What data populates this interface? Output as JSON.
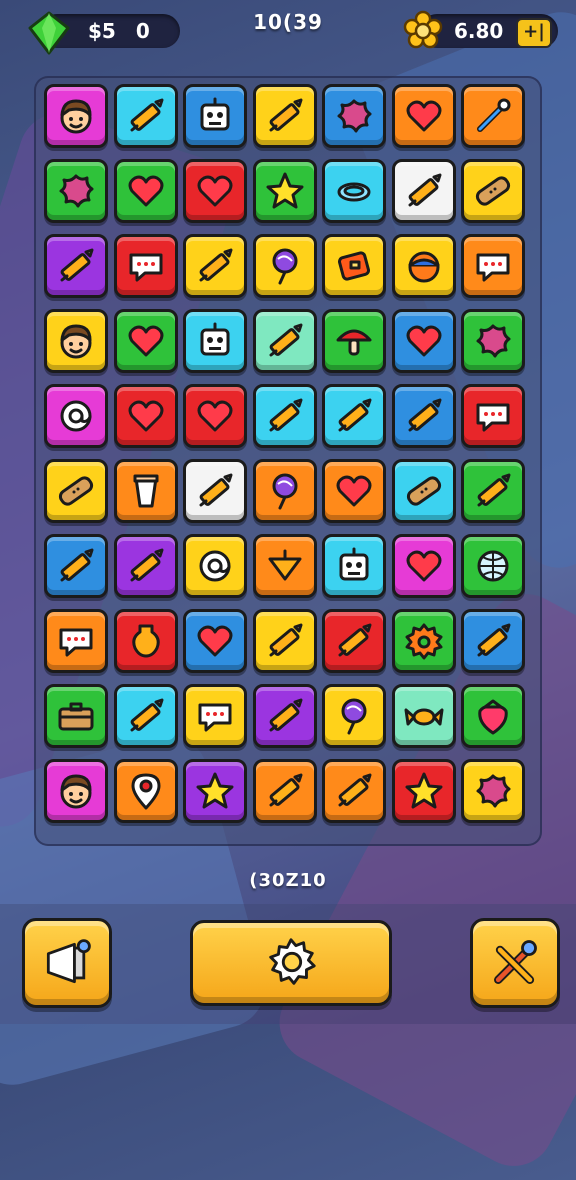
{
  "hud": {
    "currency_label": "$5",
    "currency_value": "0",
    "level_text": "10(39",
    "coins_value": "6.80",
    "add_label": "+|"
  },
  "score_text": "(30Z10",
  "colors": {
    "magenta": "#e63bd6",
    "cyan": "#3cd2f0",
    "blue": "#2f8fe0",
    "yellow": "#ffd21a",
    "orange": "#ff8a1a",
    "green": "#2fc23a",
    "red": "#e8262a",
    "purple": "#9b35e0",
    "white": "#f4f4f4",
    "mint": "#7fe8c0",
    "lime": "#c6e82a"
  },
  "board": {
    "rows": [
      [
        {
          "bg": "magenta",
          "icon": "face-icon"
        },
        {
          "bg": "cyan",
          "icon": "pencil-icon"
        },
        {
          "bg": "blue",
          "icon": "robot-icon"
        },
        {
          "bg": "yellow",
          "icon": "pencil-icon"
        },
        {
          "bg": "blue",
          "icon": "splat-icon"
        },
        {
          "bg": "orange",
          "icon": "heart-icon"
        },
        {
          "bg": "orange",
          "icon": "pin-tool-icon"
        }
      ],
      [
        {
          "bg": "green",
          "icon": "splat-icon"
        },
        {
          "bg": "green",
          "icon": "heart-icon"
        },
        {
          "bg": "red",
          "icon": "heart-icon"
        },
        {
          "bg": "green",
          "icon": "star-icon"
        },
        {
          "bg": "cyan",
          "icon": "ring-icon"
        },
        {
          "bg": "white",
          "icon": "pencil-icon"
        },
        {
          "bg": "yellow",
          "icon": "bandage-icon"
        }
      ],
      [
        {
          "bg": "purple",
          "icon": "pencil-icon"
        },
        {
          "bg": "red",
          "icon": "bubble-icon"
        },
        {
          "bg": "yellow",
          "icon": "pencil-icon"
        },
        {
          "bg": "yellow",
          "icon": "lollipop-icon"
        },
        {
          "bg": "yellow",
          "icon": "wallet-icon"
        },
        {
          "bg": "yellow",
          "icon": "ball-icon"
        },
        {
          "bg": "orange",
          "icon": "bubble-icon"
        }
      ],
      [
        {
          "bg": "yellow",
          "icon": "face-icon"
        },
        {
          "bg": "green",
          "icon": "heart-icon"
        },
        {
          "bg": "cyan",
          "icon": "robot-icon"
        },
        {
          "bg": "mint",
          "icon": "pencil-icon"
        },
        {
          "bg": "green",
          "icon": "mushroom-icon"
        },
        {
          "bg": "blue",
          "icon": "heart-icon"
        },
        {
          "bg": "green",
          "icon": "splat-icon"
        }
      ],
      [
        {
          "bg": "magenta",
          "icon": "at-icon"
        },
        {
          "bg": "red",
          "icon": "heart-icon"
        },
        {
          "bg": "red",
          "icon": "heart-icon"
        },
        {
          "bg": "cyan",
          "icon": "pencil-icon"
        },
        {
          "bg": "cyan",
          "icon": "pencil-icon"
        },
        {
          "bg": "blue",
          "icon": "pencil-icon"
        },
        {
          "bg": "red",
          "icon": "bubble-icon"
        }
      ],
      [
        {
          "bg": "yellow",
          "icon": "bandage-icon"
        },
        {
          "bg": "orange",
          "icon": "cup-icon"
        },
        {
          "bg": "white",
          "icon": "pencil-icon"
        },
        {
          "bg": "orange",
          "icon": "lollipop-icon"
        },
        {
          "bg": "orange",
          "icon": "heart-icon"
        },
        {
          "bg": "cyan",
          "icon": "bandage-icon"
        },
        {
          "bg": "green",
          "icon": "pencil-icon"
        }
      ],
      [
        {
          "bg": "blue",
          "icon": "pencil-icon"
        },
        {
          "bg": "purple",
          "icon": "pencil-icon"
        },
        {
          "bg": "yellow",
          "icon": "at-icon"
        },
        {
          "bg": "orange",
          "icon": "top-icon"
        },
        {
          "bg": "cyan",
          "icon": "robot-icon"
        },
        {
          "bg": "magenta",
          "icon": "heart-icon"
        },
        {
          "bg": "green",
          "icon": "globe-icon"
        }
      ],
      [
        {
          "bg": "orange",
          "icon": "bubble-icon"
        },
        {
          "bg": "red",
          "icon": "vase-icon"
        },
        {
          "bg": "blue",
          "icon": "heart-icon"
        },
        {
          "bg": "yellow",
          "icon": "pencil-icon"
        },
        {
          "bg": "red",
          "icon": "pencil-icon"
        },
        {
          "bg": "green",
          "icon": "gear-icon"
        },
        {
          "bg": "blue",
          "icon": "pencil-icon"
        }
      ],
      [
        {
          "bg": "green",
          "icon": "briefcase-icon"
        },
        {
          "bg": "cyan",
          "icon": "pencil-icon"
        },
        {
          "bg": "yellow",
          "icon": "bubble-icon"
        },
        {
          "bg": "purple",
          "icon": "pencil-icon"
        },
        {
          "bg": "yellow",
          "icon": "lollipop-icon"
        },
        {
          "bg": "mint",
          "icon": "candy-icon"
        },
        {
          "bg": "green",
          "icon": "strawberry-icon"
        }
      ],
      [
        {
          "bg": "magenta",
          "icon": "face-icon"
        },
        {
          "bg": "orange",
          "icon": "pin-icon"
        },
        {
          "bg": "purple",
          "icon": "star-icon"
        },
        {
          "bg": "orange",
          "icon": "pencil-icon"
        },
        {
          "bg": "orange",
          "icon": "pencil-icon"
        },
        {
          "bg": "red",
          "icon": "star-icon"
        },
        {
          "bg": "yellow",
          "icon": "splat-icon"
        }
      ]
    ]
  },
  "buttons": {
    "left_icon": "megaphone-icon",
    "center_icon": "gear-icon",
    "right_icon": "tools-icon"
  }
}
